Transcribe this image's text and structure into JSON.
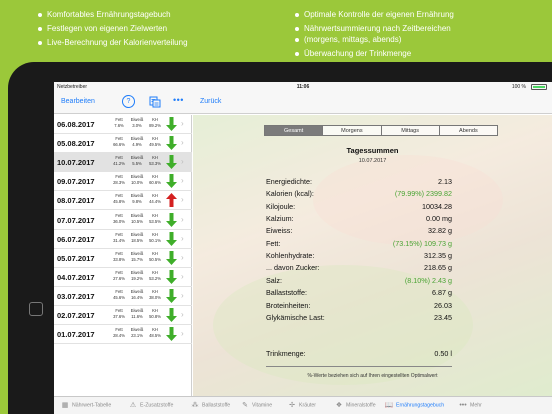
{
  "features": {
    "left": [
      "Komfortables Ernährungstagebuch",
      "Festlegen von eigenen Zielwerten",
      "Live-Berechnung der Kalorienverteilung"
    ],
    "right": [
      "Optimale Kontrolle der eigenen Ernährung",
      "Nährwertsummierung nach Zeitbereichen",
      "(morgens, mittags, abends)",
      "Überwachung der Trinkmenge"
    ]
  },
  "status": {
    "carrier": "Netzbetreiber",
    "time": "11:06",
    "battery": "100 %"
  },
  "nav": {
    "edit": "Bearbeiten",
    "help": "?",
    "more": "•••",
    "back": "Zurück"
  },
  "colors": {
    "accent": "#1f7dfa",
    "up": "#d42020",
    "down": "#3fae2a",
    "percent": "#4aa434",
    "background": "#9bc83a"
  },
  "days": [
    {
      "date": "06.08.2017",
      "fett": "7.6%",
      "eiweiss": "3.0%",
      "kh": "89.2%",
      "trend": "down"
    },
    {
      "date": "05.08.2017",
      "fett": "66.6%",
      "eiweiss": "4.9%",
      "kh": "49.5%",
      "trend": "down"
    },
    {
      "date": "10.07.2017",
      "fett": "41.2%",
      "eiweiss": "5.5%",
      "kh": "53.3%",
      "trend": "down"
    },
    {
      "date": "09.07.2017",
      "fett": "28.3%",
      "eiweiss": "10.0%",
      "kh": "60.6%",
      "trend": "down"
    },
    {
      "date": "08.07.2017",
      "fett": "45.8%",
      "eiweiss": "9.8%",
      "kh": "44.4%",
      "trend": "up"
    },
    {
      "date": "07.07.2017",
      "fett": "36.0%",
      "eiweiss": "10.5%",
      "kh": "53.5%",
      "trend": "down"
    },
    {
      "date": "06.07.2017",
      "fett": "31.4%",
      "eiweiss": "18.5%",
      "kh": "50.1%",
      "trend": "down"
    },
    {
      "date": "05.07.2017",
      "fett": "33.8%",
      "eiweiss": "15.7%",
      "kh": "50.5%",
      "trend": "down"
    },
    {
      "date": "04.07.2017",
      "fett": "27.6%",
      "eiweiss": "19.2%",
      "kh": "53.2%",
      "trend": "down"
    },
    {
      "date": "03.07.2017",
      "fett": "45.6%",
      "eiweiss": "16.4%",
      "kh": "38.0%",
      "trend": "down"
    },
    {
      "date": "02.07.2017",
      "fett": "37.6%",
      "eiweiss": "11.6%",
      "kh": "50.8%",
      "trend": "down"
    },
    {
      "date": "01.07.2017",
      "fett": "28.4%",
      "eiweiss": "23.1%",
      "kh": "48.5%",
      "trend": "down"
    }
  ],
  "stat_labels": {
    "fett": "Fett",
    "eiweiss": "Eiweiß",
    "kh": "KH"
  },
  "selected_index": 2,
  "segments": [
    "Gesamt",
    "Morgens",
    "Mittags",
    "Abends"
  ],
  "active_segment": 0,
  "summary": {
    "title": "Tagessummen",
    "date": "10.07.2017",
    "rows": [
      {
        "label": "Energiedichte:",
        "value": "2.13"
      },
      {
        "label": "Kalorien (kcal):",
        "pct": "(79.99%)",
        "value": "2399.82"
      },
      {
        "label": "Kilojoule:",
        "value": "10034.28"
      },
      {
        "label": "Kalzium:",
        "value": "0.00 mg"
      },
      {
        "label": "Eiweiss:",
        "value": "32.82 g"
      },
      {
        "label": "Fett:",
        "pct": "(73.15%)",
        "value": "109.73 g"
      },
      {
        "label": "Kohlenhydrate:",
        "value": "312.35 g"
      },
      {
        "label": "... davon Zucker:",
        "value": "218.65 g"
      },
      {
        "label": "Salz:",
        "pct": "(8.10%)",
        "value": "2.43 g"
      },
      {
        "label": "Ballaststoffe:",
        "value": "6.87 g"
      },
      {
        "label": "Broteinheiten:",
        "value": "26.03"
      },
      {
        "label": "Glykämische Last:",
        "value": "23.45"
      },
      {
        "label": "Trinkmenge:",
        "value": "0.50 l"
      }
    ],
    "footnote": "%-Werte beziehen sich auf Ihren eingestellten Optimalwert"
  },
  "tabs": [
    {
      "name": "tab-naehrwert-tabelle",
      "label": "Nährwert-Tabelle",
      "icon": "table-icon",
      "glyph": "▦"
    },
    {
      "name": "tab-e-zusatzstoffe",
      "label": "E-Zusatzstoffe",
      "icon": "warning-icon",
      "glyph": "⚠"
    },
    {
      "name": "tab-ballaststoffe",
      "label": "Ballaststoffe",
      "icon": "wheat-icon",
      "glyph": "⁂"
    },
    {
      "name": "tab-vitamine",
      "label": "Vitamine",
      "icon": "pill-icon",
      "glyph": "✎"
    },
    {
      "name": "tab-kraeuter",
      "label": "Kräuter",
      "icon": "herb-icon",
      "glyph": "✢"
    },
    {
      "name": "tab-mineralstoffe",
      "label": "Mineralstoffe",
      "icon": "mineral-icon",
      "glyph": "❖"
    },
    {
      "name": "tab-ernaehrungstagebuch",
      "label": "Ernährungstagebuch",
      "icon": "book-icon",
      "glyph": "📖"
    },
    {
      "name": "tab-mehr",
      "label": "Mehr",
      "icon": "more-icon",
      "glyph": "•••"
    }
  ],
  "active_tab": 6
}
